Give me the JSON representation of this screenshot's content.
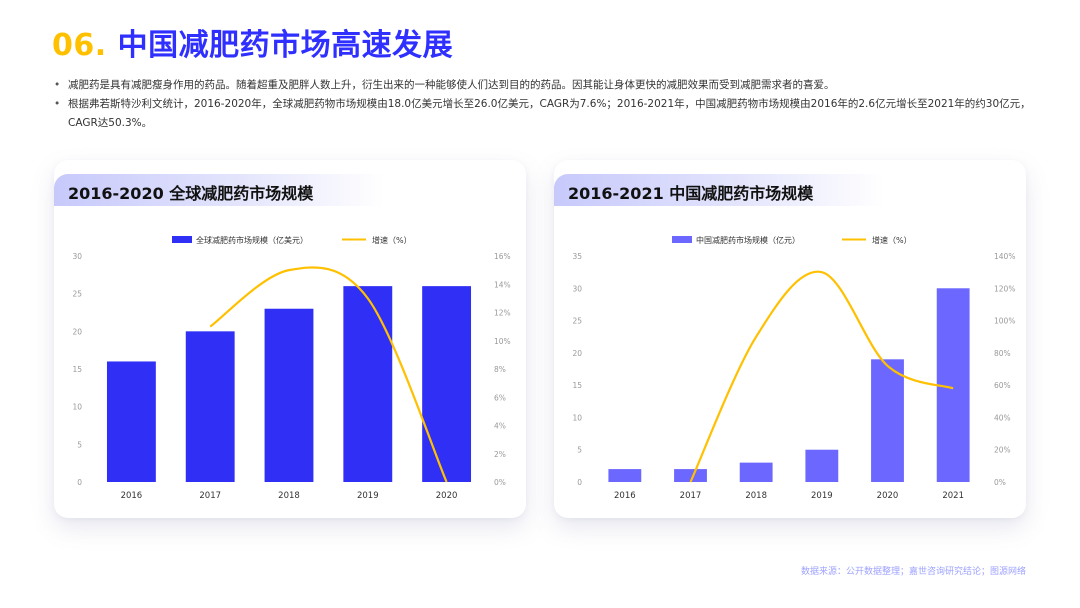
{
  "title": {
    "num": "06.",
    "text": "中国减肥药市场高速发展"
  },
  "bullets": [
    "减肥药是具有减肥瘦身作用的药品。随着超重及肥胖人数上升，衍生出来的一种能够使人们达到目的的药品。因其能让身体更快的减肥效果而受到减肥需求者的喜爱。",
    "根据弗若斯特沙利文统计，2016-2020年，全球减肥药物市场规模由18.0亿美元增长至26.0亿美元，CAGR为7.6%；2016-2021年，中国减肥药物市场规模由2016年的2.6亿元增长至2021年的约30亿元，CAGR达50.3%。"
  ],
  "cards": [
    {
      "title": "2016-2020 全球减肥药市场规模"
    },
    {
      "title": "2016-2021 中国减肥药市场规模"
    }
  ],
  "source": "数据来源：公开数据整理；嘉世咨询研究结论；图源网络",
  "colors": {
    "accent_yellow": "#ffc000",
    "title_blue": "#2f2fff",
    "bar1": "#2f2ff6",
    "bar2": "#6b67ff",
    "line": "#ffc000"
  },
  "chart_data": [
    {
      "type": "bar",
      "title": "2016-2020 全球减肥药市场规模",
      "categories": [
        "2016",
        "2017",
        "2018",
        "2019",
        "2020"
      ],
      "series": [
        {
          "name": "全球减肥药市场规模（亿美元）",
          "type": "bar",
          "axis": "left",
          "values": [
            16,
            20,
            23,
            26,
            26
          ]
        },
        {
          "name": "增速（%）",
          "type": "line",
          "axis": "right",
          "values": [
            null,
            11,
            15,
            13,
            0
          ]
        }
      ],
      "y_left": {
        "min": 0,
        "max": 30,
        "ticks": [
          "0",
          "5",
          "10",
          "15",
          "20",
          "25",
          "30"
        ]
      },
      "y_right": {
        "min": 0,
        "max": 16,
        "ticks": [
          "0%",
          "2%",
          "4%",
          "6%",
          "8%",
          "10%",
          "12%",
          "14%",
          "16%"
        ]
      },
      "legend": "top-center",
      "grid": false
    },
    {
      "type": "bar",
      "title": "2016-2021 中国减肥药市场规模",
      "categories": [
        "2016",
        "2017",
        "2018",
        "2019",
        "2020",
        "2021"
      ],
      "series": [
        {
          "name": "中国减肥药市场规模（亿元）",
          "type": "bar",
          "axis": "left",
          "values": [
            2,
            2,
            3,
            5,
            19,
            30
          ]
        },
        {
          "name": "增速（%）",
          "type": "line",
          "axis": "right",
          "values": [
            null,
            0,
            90,
            130,
            72,
            58
          ]
        }
      ],
      "y_left": {
        "min": 0,
        "max": 35,
        "ticks": [
          "0",
          "5",
          "10",
          "15",
          "20",
          "25",
          "30",
          "35"
        ]
      },
      "y_right": {
        "min": 0,
        "max": 140,
        "ticks": [
          "0%",
          "20%",
          "40%",
          "60%",
          "80%",
          "100%",
          "120%",
          "140%"
        ]
      },
      "legend": "top-center",
      "grid": false
    }
  ]
}
